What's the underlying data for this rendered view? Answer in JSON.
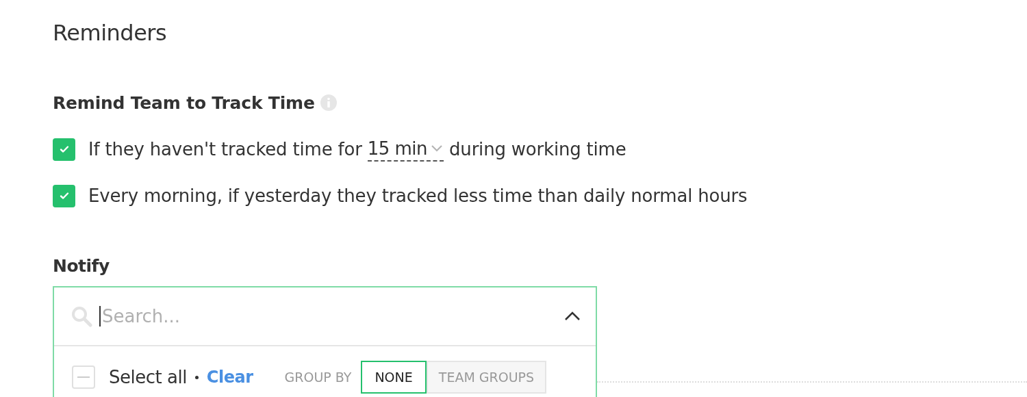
{
  "title": "Reminders",
  "section": {
    "heading": "Remind Team to Track Time"
  },
  "reminders": [
    {
      "kind": "interval",
      "checked": true,
      "text_before": "If they haven't tracked time for",
      "value": "15 min",
      "text_after": "during working time"
    },
    {
      "kind": "plain",
      "checked": true,
      "text": "Every morning, if yesterday they tracked less time than daily normal hours"
    }
  ],
  "notify": {
    "label": "Notify",
    "search": {
      "placeholder": "Search..."
    },
    "expanded": true,
    "select_all": {
      "label": "Select all",
      "checked": false,
      "clear": "Clear"
    },
    "group_by": {
      "label": "GROUP BY",
      "options": [
        {
          "label": "NONE",
          "selected": true
        },
        {
          "label": "TEAM GROUPS",
          "selected": false
        }
      ]
    }
  }
}
